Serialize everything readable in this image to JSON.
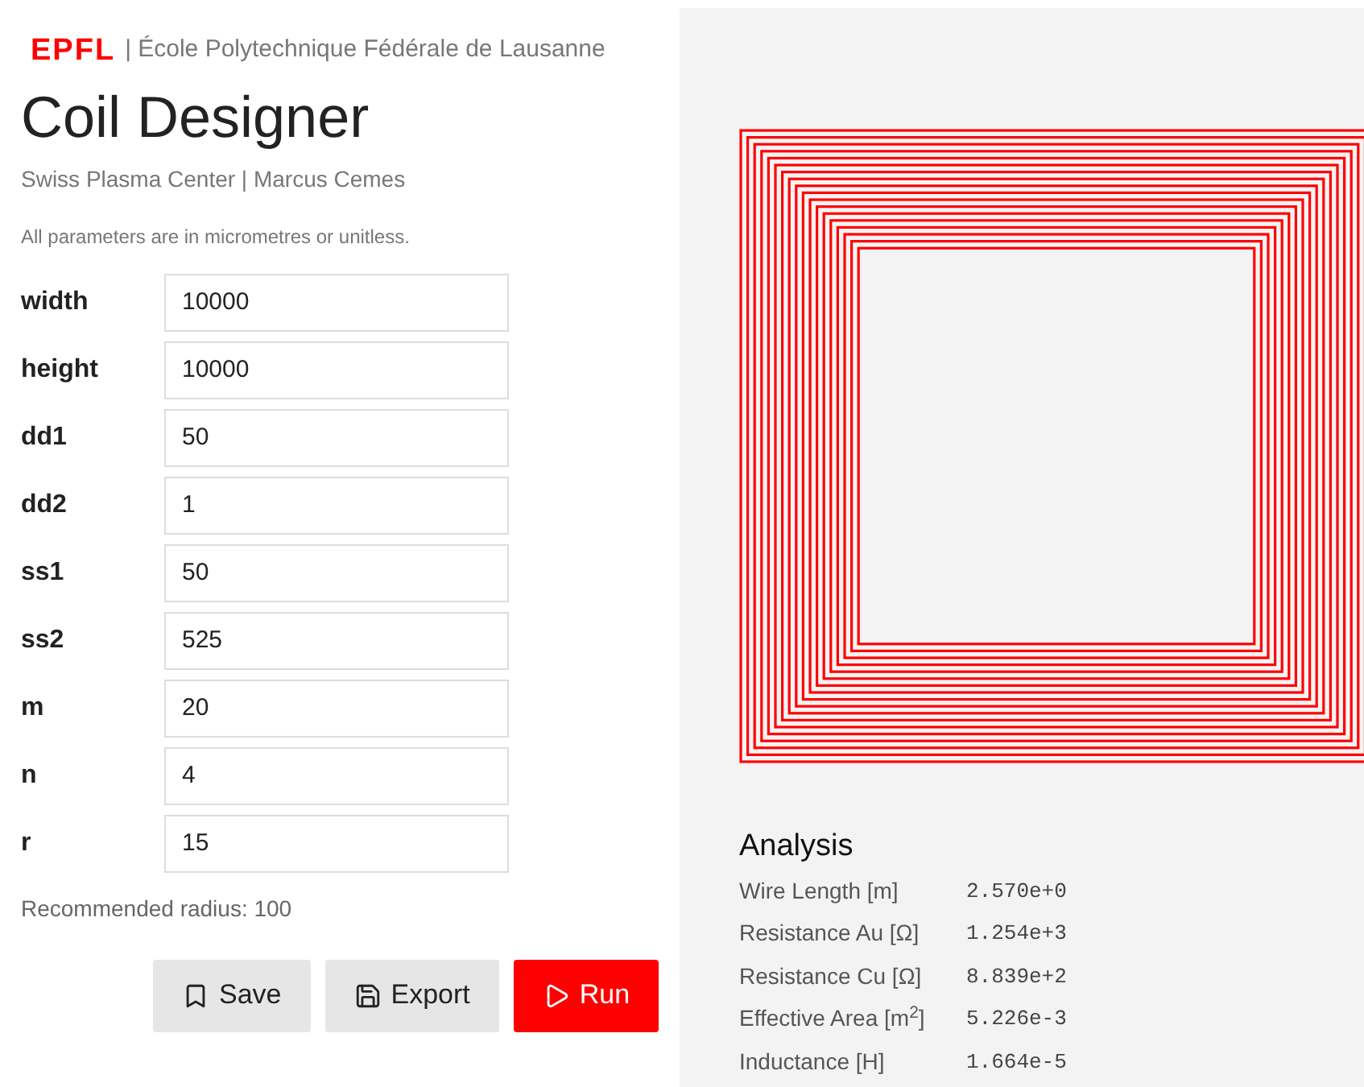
{
  "header": {
    "logo": "EPFL",
    "institution": "| École Polytechnique Fédérale de Lausanne"
  },
  "title": "Coil Designer",
  "subtitle": "Swiss Plasma Center | Marcus Cemes",
  "note": "All parameters are in micrometres or unitless.",
  "parameters": [
    {
      "label": "width",
      "value": "10000"
    },
    {
      "label": "height",
      "value": "10000"
    },
    {
      "label": "dd1",
      "value": "50"
    },
    {
      "label": "dd2",
      "value": "1"
    },
    {
      "label": "ss1",
      "value": "50"
    },
    {
      "label": "ss2",
      "value": "525"
    },
    {
      "label": "m",
      "value": "20"
    },
    {
      "label": "n",
      "value": "4"
    },
    {
      "label": "r",
      "value": "15"
    }
  ],
  "recommendation": "Recommended radius: 100",
  "buttons": [
    {
      "label": "Save",
      "kind": "save"
    },
    {
      "label": "Export",
      "kind": "export"
    },
    {
      "label": "Run",
      "kind": "run"
    }
  ],
  "analysis": {
    "title": "Analysis",
    "rows": [
      {
        "label": "Wire Length [m]",
        "value": "2.570e+0"
      },
      {
        "label": "Resistance Au [Ω]",
        "value": "1.254e+3"
      },
      {
        "label": "Resistance Cu [Ω]",
        "value": "8.839e+2"
      },
      {
        "label": "Effective Area [m$^{2}$]",
        "value": "5.226e-3"
      },
      {
        "label": "Inductance [H]",
        "value": "1.664e-5"
      }
    ]
  }
}
